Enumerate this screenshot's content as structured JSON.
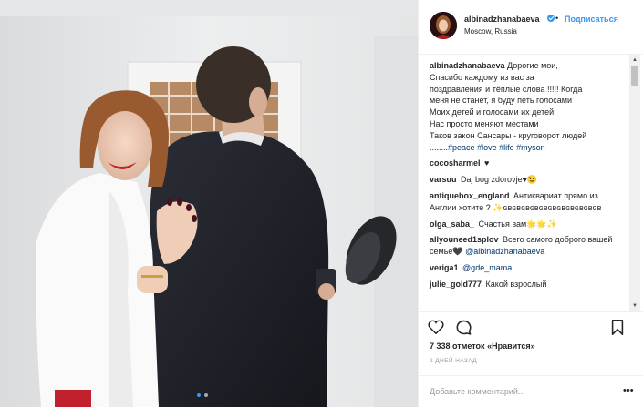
{
  "post": {
    "username": "albinadzhanabaeva",
    "separator": "•",
    "follow_label": "Подписаться",
    "location": "Moscow, Russia"
  },
  "caption": {
    "username": "albinadzhanabaeva",
    "lines": [
      "Дорогие мои,",
      "Спасибо каждому из вас за",
      "поздравления и тёплые слова !!!!! Когда",
      "меня не станет, я буду петь голосами",
      "Моих детей и голосами их детей",
      "Нас просто меняют местами",
      "Таков закон Сансары - круговорот людей"
    ],
    "dots": "........",
    "hashtags": [
      "#peace",
      "#love",
      "#life",
      "#myson"
    ]
  },
  "comments": [
    {
      "user": "cocosharmel",
      "text": "♥"
    },
    {
      "user": "varsuu",
      "text": "Daj bog zdorovje♥😉"
    },
    {
      "user": "antiquebox_england",
      "text": "Антиквариат прямо из Англии хотите ? ✨ɢʙɢʙɢʙɢʙɢʙɢʙɢʙɢʙɢʙɢʙɢʙ"
    },
    {
      "user": "olga_saba_",
      "text": "Счастья вам🌟🌟✨"
    },
    {
      "user": "allyouneed1splov",
      "text": "Всего самого доброго вашей семье🖤",
      "mention": "@albinadzhanabaeva"
    },
    {
      "user": "veriga1",
      "text": "",
      "mention": "@gde_mama"
    },
    {
      "user": "julie_gold777",
      "text": "Какой взрослый"
    }
  ],
  "stats": {
    "likes_count": "7 338 отметок",
    "likes_link": "«Нравится»",
    "time_ago": "2 дней назад"
  },
  "add_comment": {
    "placeholder": "Добавьте комментарий..."
  },
  "icons": {
    "like": "heart-icon",
    "comment": "comment-icon",
    "save": "bookmark-icon",
    "verified": "verified-badge-icon",
    "more": "more-options-icon"
  },
  "colors": {
    "accent": "#3897f0",
    "link": "#003569",
    "text": "#262626",
    "muted": "#999999"
  }
}
